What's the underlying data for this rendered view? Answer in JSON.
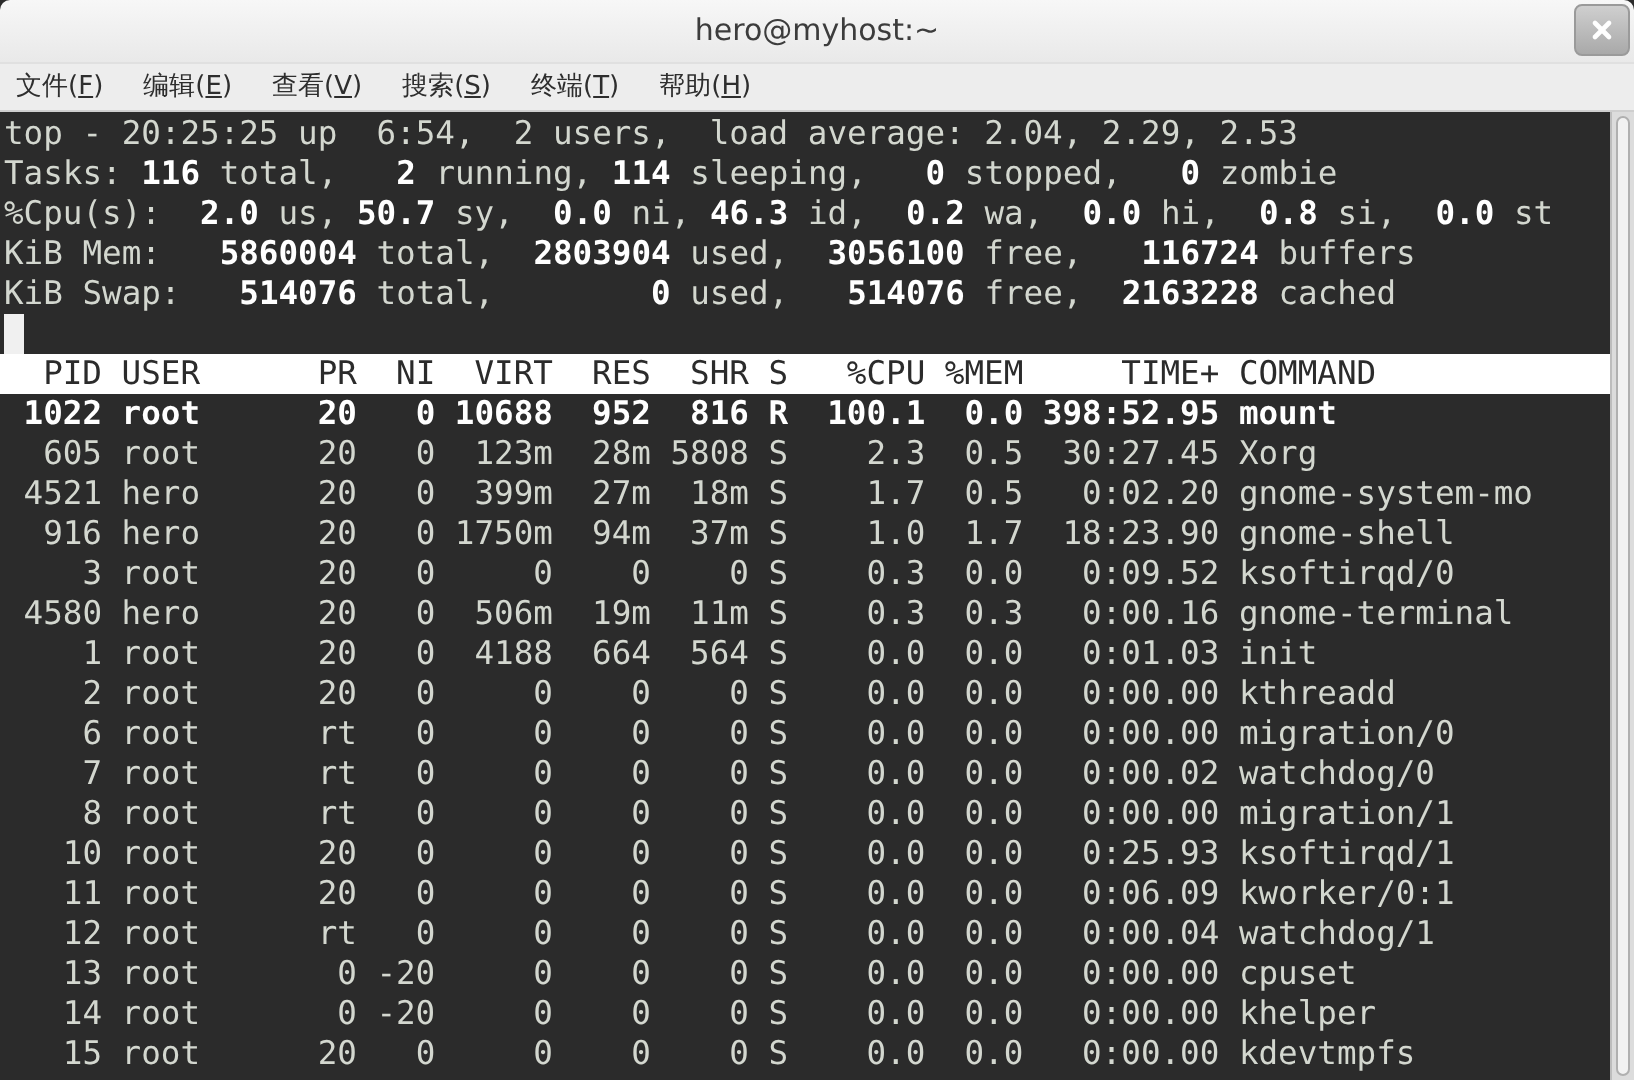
{
  "window": {
    "title": "hero@myhost:~"
  },
  "menu": [
    {
      "before": "文件(",
      "key": "F",
      "after": ")"
    },
    {
      "before": "编辑(",
      "key": "E",
      "after": ")"
    },
    {
      "before": "查看(",
      "key": "V",
      "after": ")"
    },
    {
      "before": "搜索(",
      "key": "S",
      "after": ")"
    },
    {
      "before": "终端(",
      "key": "T",
      "after": ")"
    },
    {
      "before": "帮助(",
      "key": "H",
      "after": ")"
    }
  ],
  "summary": [
    "top - 20:25:25 up  6:54,  2 users,  load average: 2.04, 2.29, 2.53",
    "Tasks: **116** total,   **2** running, **114** sleeping,   **0** stopped,   **0** zombie",
    "%Cpu(s):  **2.0** us, **50.7** sy,  **0.0** ni, **46.3** id,  **0.2** wa,  **0.0** hi,  **0.8** si,  **0.0** st",
    "KiB Mem:   **5860004** total,  **2803904** used,  **3056100** free,   **116724** buffers",
    "KiB Swap:   **514076** total,        **0** used,   **514076** free,  **2163228** cached"
  ],
  "table": {
    "columns": [
      "PID",
      "USER",
      "PR",
      "NI",
      "VIRT",
      "RES",
      "SHR",
      "S",
      "%CPU",
      "%MEM",
      "TIME+",
      "COMMAND"
    ],
    "rows": [
      {
        "highlighted": true,
        "cells": [
          "1022",
          "root",
          "20",
          "0",
          "10688",
          "952",
          "816",
          "R",
          "100.1",
          "0.0",
          "398:52.95",
          "mount"
        ]
      },
      {
        "highlighted": false,
        "cells": [
          "605",
          "root",
          "20",
          "0",
          "123m",
          "28m",
          "5808",
          "S",
          "2.3",
          "0.5",
          "30:27.45",
          "Xorg"
        ]
      },
      {
        "highlighted": false,
        "cells": [
          "4521",
          "hero",
          "20",
          "0",
          "399m",
          "27m",
          "18m",
          "S",
          "1.7",
          "0.5",
          "0:02.20",
          "gnome-system-mo"
        ]
      },
      {
        "highlighted": false,
        "cells": [
          "916",
          "hero",
          "20",
          "0",
          "1750m",
          "94m",
          "37m",
          "S",
          "1.0",
          "1.7",
          "18:23.90",
          "gnome-shell"
        ]
      },
      {
        "highlighted": false,
        "cells": [
          "3",
          "root",
          "20",
          "0",
          "0",
          "0",
          "0",
          "S",
          "0.3",
          "0.0",
          "0:09.52",
          "ksoftirqd/0"
        ]
      },
      {
        "highlighted": false,
        "cells": [
          "4580",
          "hero",
          "20",
          "0",
          "506m",
          "19m",
          "11m",
          "S",
          "0.3",
          "0.3",
          "0:00.16",
          "gnome-terminal"
        ]
      },
      {
        "highlighted": false,
        "cells": [
          "1",
          "root",
          "20",
          "0",
          "4188",
          "664",
          "564",
          "S",
          "0.0",
          "0.0",
          "0:01.03",
          "init"
        ]
      },
      {
        "highlighted": false,
        "cells": [
          "2",
          "root",
          "20",
          "0",
          "0",
          "0",
          "0",
          "S",
          "0.0",
          "0.0",
          "0:00.00",
          "kthreadd"
        ]
      },
      {
        "highlighted": false,
        "cells": [
          "6",
          "root",
          "rt",
          "0",
          "0",
          "0",
          "0",
          "S",
          "0.0",
          "0.0",
          "0:00.00",
          "migration/0"
        ]
      },
      {
        "highlighted": false,
        "cells": [
          "7",
          "root",
          "rt",
          "0",
          "0",
          "0",
          "0",
          "S",
          "0.0",
          "0.0",
          "0:00.02",
          "watchdog/0"
        ]
      },
      {
        "highlighted": false,
        "cells": [
          "8",
          "root",
          "rt",
          "0",
          "0",
          "0",
          "0",
          "S",
          "0.0",
          "0.0",
          "0:00.00",
          "migration/1"
        ]
      },
      {
        "highlighted": false,
        "cells": [
          "10",
          "root",
          "20",
          "0",
          "0",
          "0",
          "0",
          "S",
          "0.0",
          "0.0",
          "0:25.93",
          "ksoftirqd/1"
        ]
      },
      {
        "highlighted": false,
        "cells": [
          "11",
          "root",
          "20",
          "0",
          "0",
          "0",
          "0",
          "S",
          "0.0",
          "0.0",
          "0:06.09",
          "kworker/0:1"
        ]
      },
      {
        "highlighted": false,
        "cells": [
          "12",
          "root",
          "rt",
          "0",
          "0",
          "0",
          "0",
          "S",
          "0.0",
          "0.0",
          "0:00.04",
          "watchdog/1"
        ]
      },
      {
        "highlighted": false,
        "cells": [
          "13",
          "root",
          "0",
          "-20",
          "0",
          "0",
          "0",
          "S",
          "0.0",
          "0.0",
          "0:00.00",
          "cpuset"
        ]
      },
      {
        "highlighted": false,
        "cells": [
          "14",
          "root",
          "0",
          "-20",
          "0",
          "0",
          "0",
          "S",
          "0.0",
          "0.0",
          "0:00.00",
          "khelper"
        ]
      },
      {
        "highlighted": false,
        "cells": [
          "15",
          "root",
          "20",
          "0",
          "0",
          "0",
          "0",
          "S",
          "0.0",
          "0.0",
          "0:00.00",
          "kdevtmpfs"
        ]
      }
    ]
  }
}
